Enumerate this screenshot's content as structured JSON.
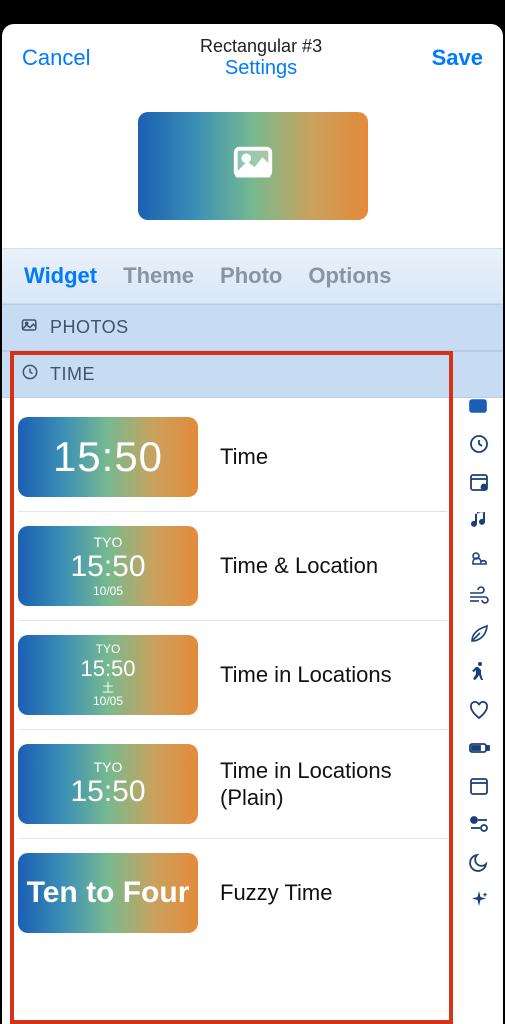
{
  "header": {
    "cancel": "Cancel",
    "title": "Rectangular #3",
    "subtitle": "Settings",
    "save": "Save"
  },
  "tabs": {
    "widget": "Widget",
    "theme": "Theme",
    "photo": "Photo",
    "options": "Options"
  },
  "sections": {
    "photos": "PHOTOS",
    "time": "TIME"
  },
  "time_items": [
    {
      "label": "Time",
      "line1": "15:50"
    },
    {
      "label": "Time & Location",
      "top": "TYO",
      "line1": "15:50",
      "sub": "10/05"
    },
    {
      "label": "Time in Locations",
      "top": "TYO",
      "line1": "15:50",
      "sub": "土\n10/05"
    },
    {
      "label": "Time in Locations (Plain)",
      "top": "TYO",
      "line1": "15:50"
    },
    {
      "label": "Fuzzy Time",
      "fuzzy": "Ten to Four"
    }
  ]
}
